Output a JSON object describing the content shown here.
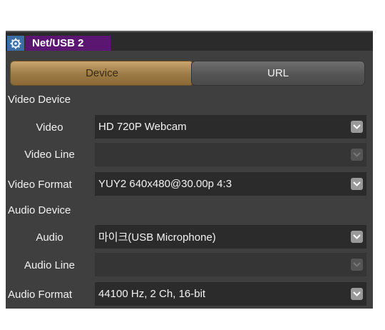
{
  "window": {
    "title": "Net/USB 2",
    "settings_icon": "gear-icon"
  },
  "tabs": [
    {
      "label": "Device",
      "selected": true
    },
    {
      "label": "URL",
      "selected": false
    }
  ],
  "video_section": {
    "title": "Video Device",
    "fields": [
      {
        "label": "Video",
        "value": "HD 720P Webcam",
        "enabled": true
      },
      {
        "label": "Video Line",
        "value": "",
        "enabled": false
      },
      {
        "label": "Video Format",
        "value": "YUY2 640x480@30.00p 4:3",
        "enabled": true
      }
    ]
  },
  "audio_section": {
    "title": "Audio Device",
    "fields": [
      {
        "label": "Audio",
        "value": "마이크(USB Microphone)",
        "enabled": true
      },
      {
        "label": "Audio Line",
        "value": "",
        "enabled": false
      },
      {
        "label": "Audio Format",
        "value": "44100 Hz, 2 Ch, 16-bit",
        "enabled": true
      }
    ]
  },
  "colors": {
    "panel_bg": "#3f3f3f",
    "title_tab": "#5a1670",
    "gear_button": "#3a6ea5",
    "selected_tab": "#b08a52"
  },
  "icons": {
    "dropdown": "chevron-down-icon"
  }
}
